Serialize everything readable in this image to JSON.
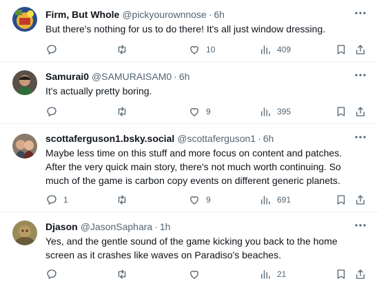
{
  "posts": [
    {
      "name": "Firm, But Whole",
      "handle": "@pickyourownnose",
      "time": "6h",
      "text": "But there's nothing for us to do there! It's all just window dressing.",
      "replies": "",
      "reposts": "",
      "likes": "10",
      "views": "409"
    },
    {
      "name": "Samurai0",
      "handle": "@SAMURAISAM0",
      "time": "6h",
      "text": "It's actually pretty boring.",
      "replies": "",
      "reposts": "",
      "likes": "9",
      "views": "395"
    },
    {
      "name": "scottaferguson1.bsky.social",
      "handle": "@scottaferguson1",
      "time": "6h",
      "text": "Maybe less time on this stuff and more focus on content and patches. After the very quick main story, there's not much worth continuing. So much of the game is carbon copy events on different generic planets.",
      "replies": "1",
      "reposts": "",
      "likes": "9",
      "views": "691"
    },
    {
      "name": "Djason",
      "handle": "@JasonSaphara",
      "time": "1h",
      "text": "Yes, and the gentle sound of the game kicking you back to the home screen as it crashes like waves on Paradiso's beaches.",
      "replies": "",
      "reposts": "",
      "likes": "",
      "views": "21"
    }
  ],
  "ui": {
    "separator": "·",
    "accent": "#1d9bf0",
    "text_secondary": "#536471",
    "icons": [
      "reply-icon",
      "repost-icon",
      "like-icon",
      "views-icon",
      "bookmark-icon",
      "share-icon",
      "more-icon"
    ]
  }
}
